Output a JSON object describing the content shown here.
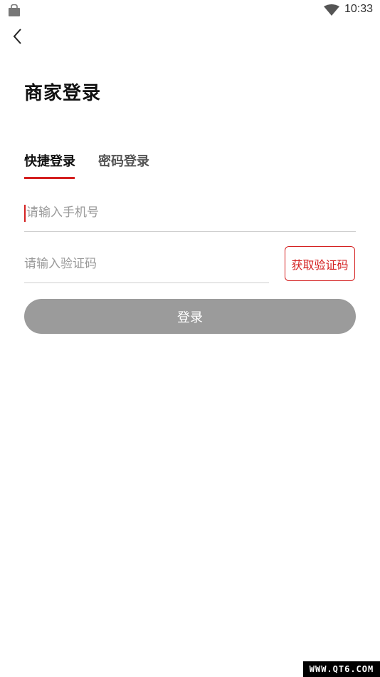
{
  "status_bar": {
    "time": "10:33",
    "left_icon": "bag-icon",
    "right_icon": "wifi-icon"
  },
  "header": {
    "back_icon": "chevron-left-icon",
    "title": "商家登录"
  },
  "tabs": [
    {
      "label": "快捷登录",
      "active": true
    },
    {
      "label": "密码登录",
      "active": false
    }
  ],
  "form": {
    "phone_placeholder": "请输入手机号",
    "phone_value": "",
    "code_placeholder": "请输入验证码",
    "code_value": "",
    "get_code_label": "获取验证码",
    "login_label": "登录"
  },
  "colors": {
    "accent": "#d42020",
    "button_disabled": "#9b9b9b"
  },
  "watermark": "WWW.QT6.COM"
}
